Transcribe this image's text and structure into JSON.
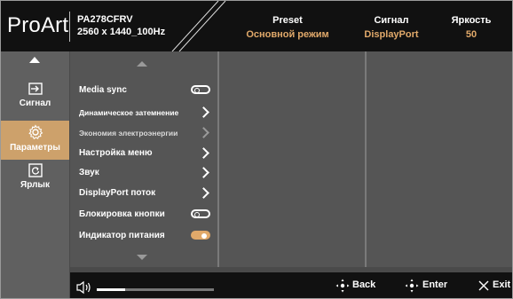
{
  "header": {
    "brand": "ProArt",
    "model": "PA278CFRV",
    "resolution": "2560 x 1440_100Hz",
    "preset": {
      "label": "Preset",
      "value": "Основной режим"
    },
    "signal": {
      "label": "Сигнал",
      "value": "DisplayPort"
    },
    "brightness": {
      "label": "Яркость",
      "value": "50"
    }
  },
  "sidebar": {
    "items": [
      {
        "label": "Сигнал",
        "icon": "input-signal-icon"
      },
      {
        "label": "Параметры",
        "icon": "gear-icon",
        "active": true
      },
      {
        "label": "Ярлык",
        "icon": "shortcut-icon"
      }
    ]
  },
  "menu": {
    "items": [
      {
        "label": "Media sync",
        "control": "toggle-off"
      },
      {
        "label": "Динамическое затемнение",
        "control": "chevron"
      },
      {
        "label": "Экономия электроэнергии",
        "control": "chevron-disabled"
      },
      {
        "label": "Настройка меню",
        "control": "chevron"
      },
      {
        "label": "Звук",
        "control": "chevron"
      },
      {
        "label": "DisplayPort поток",
        "control": "chevron"
      },
      {
        "label": "Блокировка кнопки",
        "control": "toggle-off"
      },
      {
        "label": "Индикатор питания",
        "control": "toggle-on"
      }
    ]
  },
  "footer": {
    "volume_fraction": 0.24,
    "back_label": "Back",
    "enter_label": "Enter",
    "exit_label": "Exit"
  },
  "colors": {
    "accent": "#e1a96a",
    "active_tab": "#cda16b"
  }
}
